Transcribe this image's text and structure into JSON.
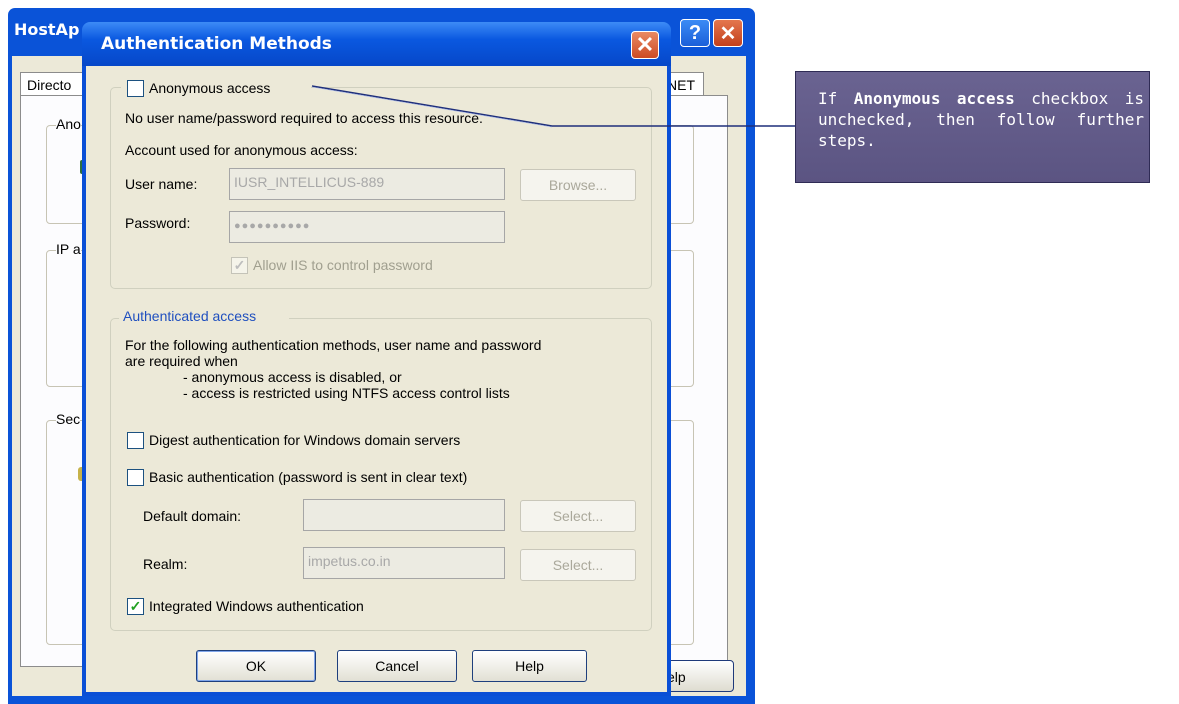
{
  "background_window": {
    "title": "HostAp",
    "tab_left": "Directo",
    "tab_right": "NET",
    "group_labels": [
      "Ano",
      "IP a",
      "Sec"
    ],
    "help_button": "elp"
  },
  "dialog": {
    "title": "Authentication Methods",
    "anonymous": {
      "checkbox_label": "Anonymous access",
      "checked": false,
      "description": "No user name/password required to access this resource.",
      "account_label": "Account used for anonymous access:",
      "username_label": "User name:",
      "username_value": "IUSR_INTELLICUS-889",
      "browse_button": "Browse...",
      "password_label": "Password:",
      "password_value": "●●●●●●●●●●",
      "allow_iis_label": "Allow IIS to control password",
      "allow_iis_checked": true
    },
    "authenticated": {
      "group_title": "Authenticated access",
      "desc_line1": "For the following authentication methods, user name and password",
      "desc_line2": "are required when",
      "desc_bullet1": "- anonymous access is disabled, or",
      "desc_bullet2": "- access is restricted using NTFS access control lists",
      "digest_label": "Digest authentication for Windows domain servers",
      "basic_label": "Basic authentication (password is sent in clear text)",
      "default_domain_label": "Default domain:",
      "default_domain_value": "",
      "select_button": "Select...",
      "realm_label": "Realm:",
      "realm_value": "impetus.co.in",
      "integrated_label": "Integrated Windows authentication",
      "integrated_checked": true
    },
    "buttons": {
      "ok": "OK",
      "cancel": "Cancel",
      "help": "Help"
    }
  },
  "callout": {
    "prefix": "If",
    "bold": "Anonymous access",
    "suffix": "checkbox is unchecked, then follow further steps."
  },
  "colors": {
    "xp_blue": "#0a4fd6",
    "dialog_face": "#ece9d8",
    "callout_bg": "#5f5887",
    "check_green": "#21a121"
  }
}
